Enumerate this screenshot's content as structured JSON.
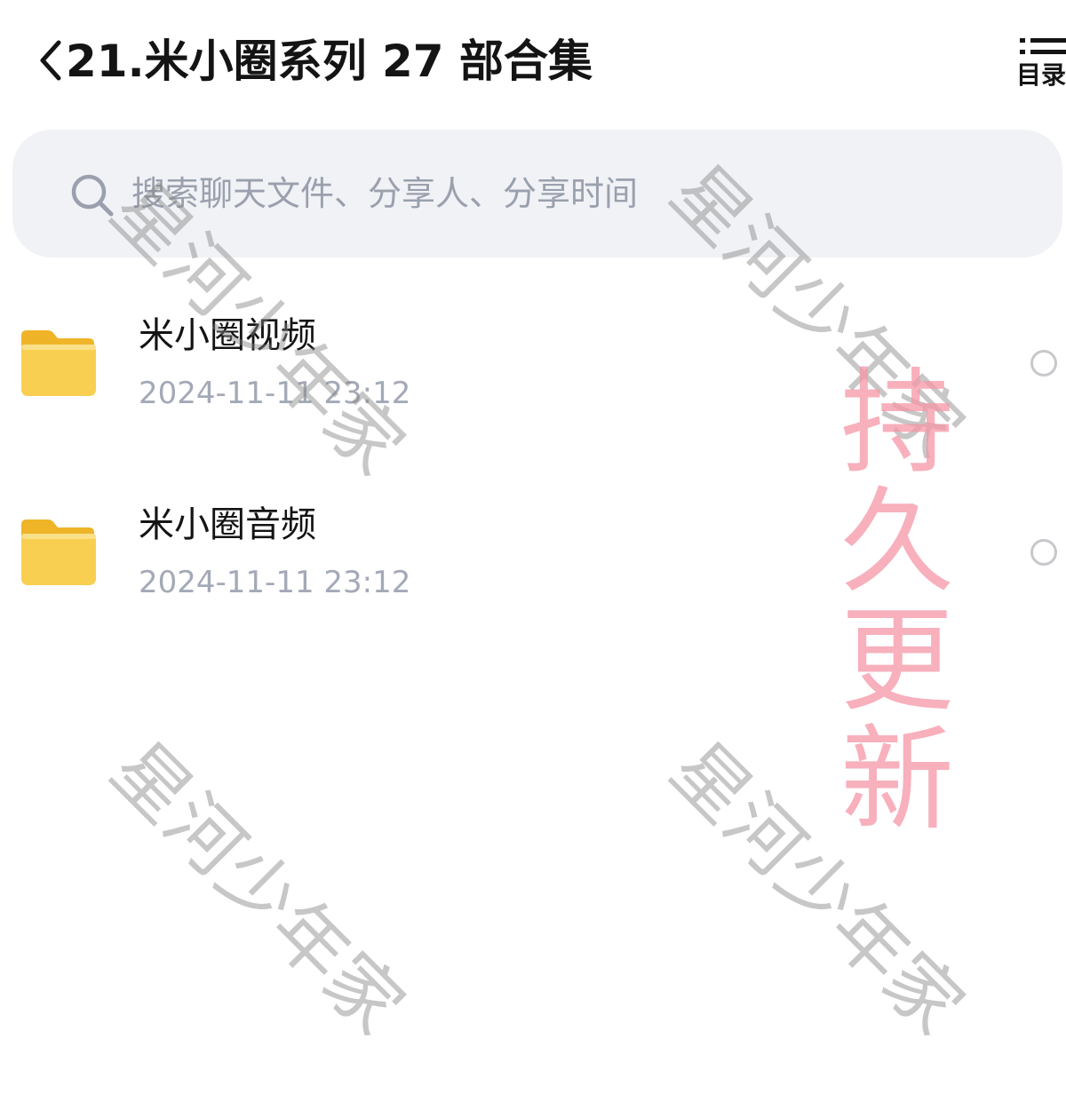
{
  "header": {
    "title": "21.米小圈系列 27 部合集",
    "toc_label": "目录"
  },
  "search": {
    "placeholder": "搜索聊天文件、分享人、分享时间"
  },
  "files": [
    {
      "name": "米小圈视频",
      "time": "2024-11-11 23:12",
      "icon": "folder-icon"
    },
    {
      "name": "米小圈音频",
      "time": "2024-11-11 23:12",
      "icon": "folder-icon"
    }
  ],
  "watermarks": {
    "text": "星河少年家",
    "promo": "持久更新"
  },
  "colors": {
    "search_bg": "#f1f2f6",
    "placeholder": "#9aa0ad",
    "timestamp": "#a4a9b7",
    "folder": "#f7c948",
    "promo": "#f496a5"
  }
}
